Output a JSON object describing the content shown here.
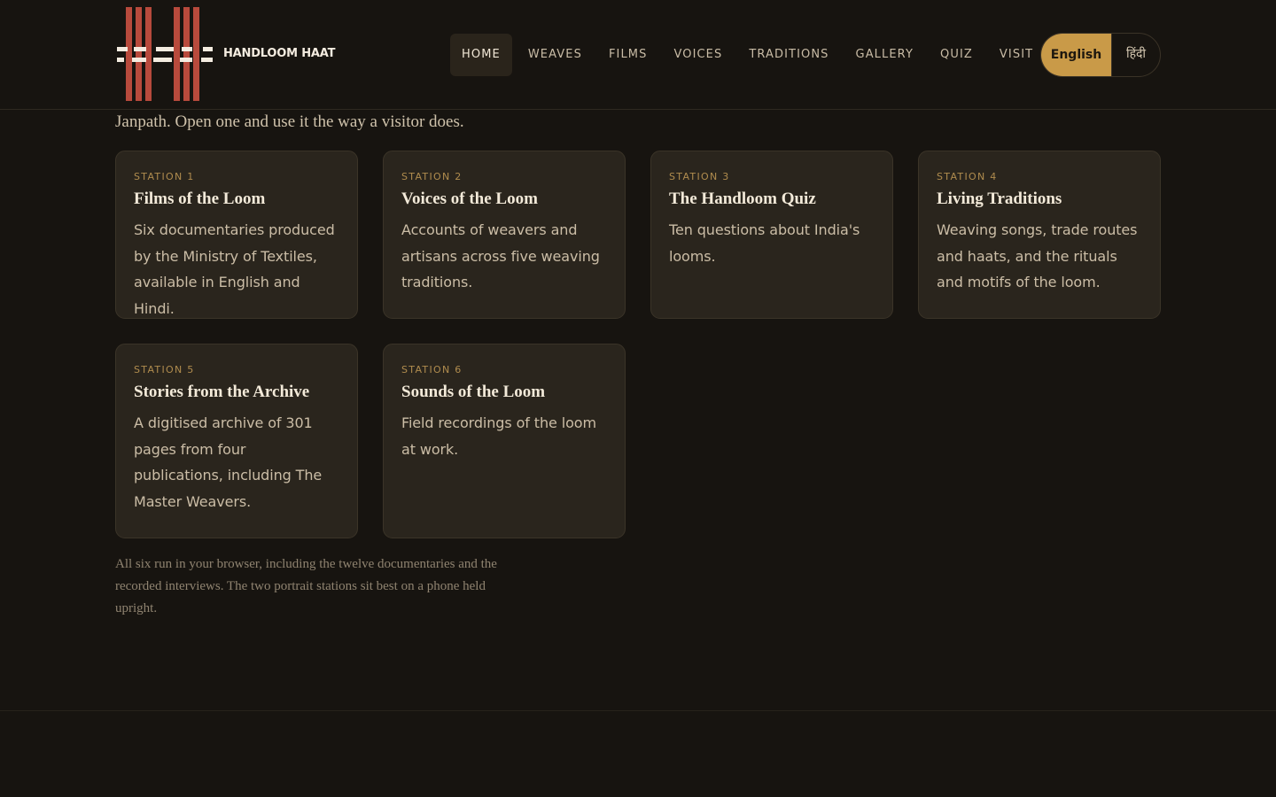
{
  "brand": {
    "name": "HANDLOOM HAAT"
  },
  "nav": {
    "items": [
      "HOME",
      "WEAVES",
      "FILMS",
      "VOICES",
      "TRADITIONS",
      "GALLERY",
      "QUIZ",
      "VISIT"
    ],
    "active": "HOME"
  },
  "language": {
    "english": "English",
    "hindi": "हिंदी",
    "selected": "English"
  },
  "intro": "Janpath. Open one and use it the way a visitor does.",
  "stations": [
    {
      "station": "STATION 1",
      "title": "Films of the Loom",
      "description": "Six documentaries produced by the Ministry of Textiles, available in English and Hindi."
    },
    {
      "station": "STATION 2",
      "title": "Voices of the Loom",
      "description": "Accounts of weavers and artisans across five weaving traditions."
    },
    {
      "station": "STATION 3",
      "title": "The Handloom Quiz",
      "description": "Ten questions about India's looms."
    },
    {
      "station": "STATION 4",
      "title": "Living Traditions",
      "description": "Weaving songs, trade routes and haats, and the rituals and motifs of the loom."
    },
    {
      "station": "STATION 5",
      "title": "Stories from the Archive",
      "description": "A digitised archive of 301 pages from four publications, including The Master Weavers."
    },
    {
      "station": "STATION 6",
      "title": "Sounds of the Loom",
      "description": "Field recordings of the loom at work."
    }
  ],
  "note": "All six run in your browser, including the twelve documentaries and the recorded interviews. The two portrait stations sit best on a phone held upright.",
  "colors": {
    "background": "#171410",
    "card": "#2a251d",
    "accent": "#c99a48",
    "logo": "#b84a3c"
  },
  "icons": {
    "logo": "handloom-logo-icon"
  }
}
